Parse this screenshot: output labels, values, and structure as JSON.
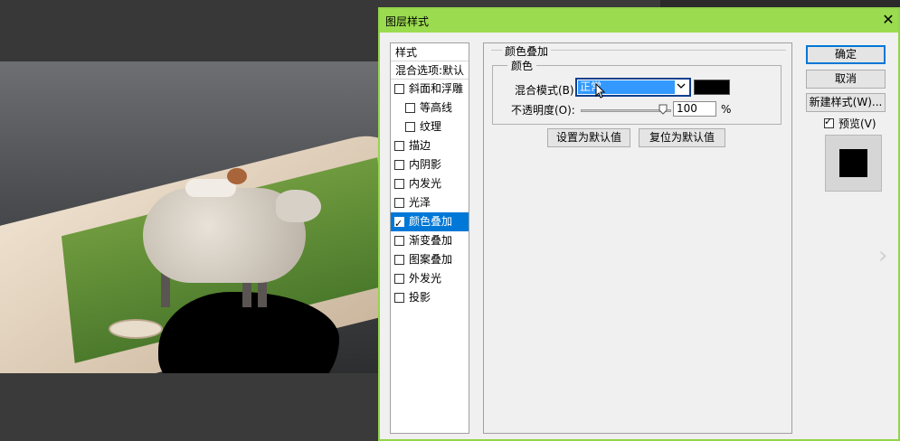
{
  "dialog": {
    "title": "图层样式",
    "close_icon": "close-icon"
  },
  "style_list": {
    "header": "样式",
    "blend_options": "混合选项:默认",
    "items": [
      {
        "label": "斜面和浮雕",
        "checked": false,
        "sub": false,
        "selected": false
      },
      {
        "label": "等高线",
        "checked": false,
        "sub": true,
        "selected": false
      },
      {
        "label": "纹理",
        "checked": false,
        "sub": true,
        "selected": false
      },
      {
        "label": "描边",
        "checked": false,
        "sub": false,
        "selected": false
      },
      {
        "label": "内阴影",
        "checked": false,
        "sub": false,
        "selected": false
      },
      {
        "label": "内发光",
        "checked": false,
        "sub": false,
        "selected": false
      },
      {
        "label": "光泽",
        "checked": false,
        "sub": false,
        "selected": false
      },
      {
        "label": "颜色叠加",
        "checked": true,
        "sub": false,
        "selected": true
      },
      {
        "label": "渐变叠加",
        "checked": false,
        "sub": false,
        "selected": false
      },
      {
        "label": "图案叠加",
        "checked": false,
        "sub": false,
        "selected": false
      },
      {
        "label": "外发光",
        "checked": false,
        "sub": false,
        "selected": false
      },
      {
        "label": "投影",
        "checked": false,
        "sub": false,
        "selected": false
      }
    ]
  },
  "panel": {
    "group_title": "颜色叠加",
    "subgroup_title": "颜色",
    "blend_mode_label": "混合模式(B):",
    "blend_mode_value": "正常",
    "overlay_color": "#000000",
    "opacity_label": "不透明度(O):",
    "opacity_value": "100",
    "opacity_unit": "%",
    "set_default_button": "设置为默认值",
    "reset_default_button": "复位为默认值"
  },
  "actions": {
    "ok": "确定",
    "cancel": "取消",
    "new_style": "新建样式(W)...",
    "preview_label": "预览(V)",
    "preview_checked": true
  },
  "colors": {
    "titlebar": "#9bdb4f",
    "selection": "#0078d7",
    "dialog_bg": "#f0f0f0"
  }
}
